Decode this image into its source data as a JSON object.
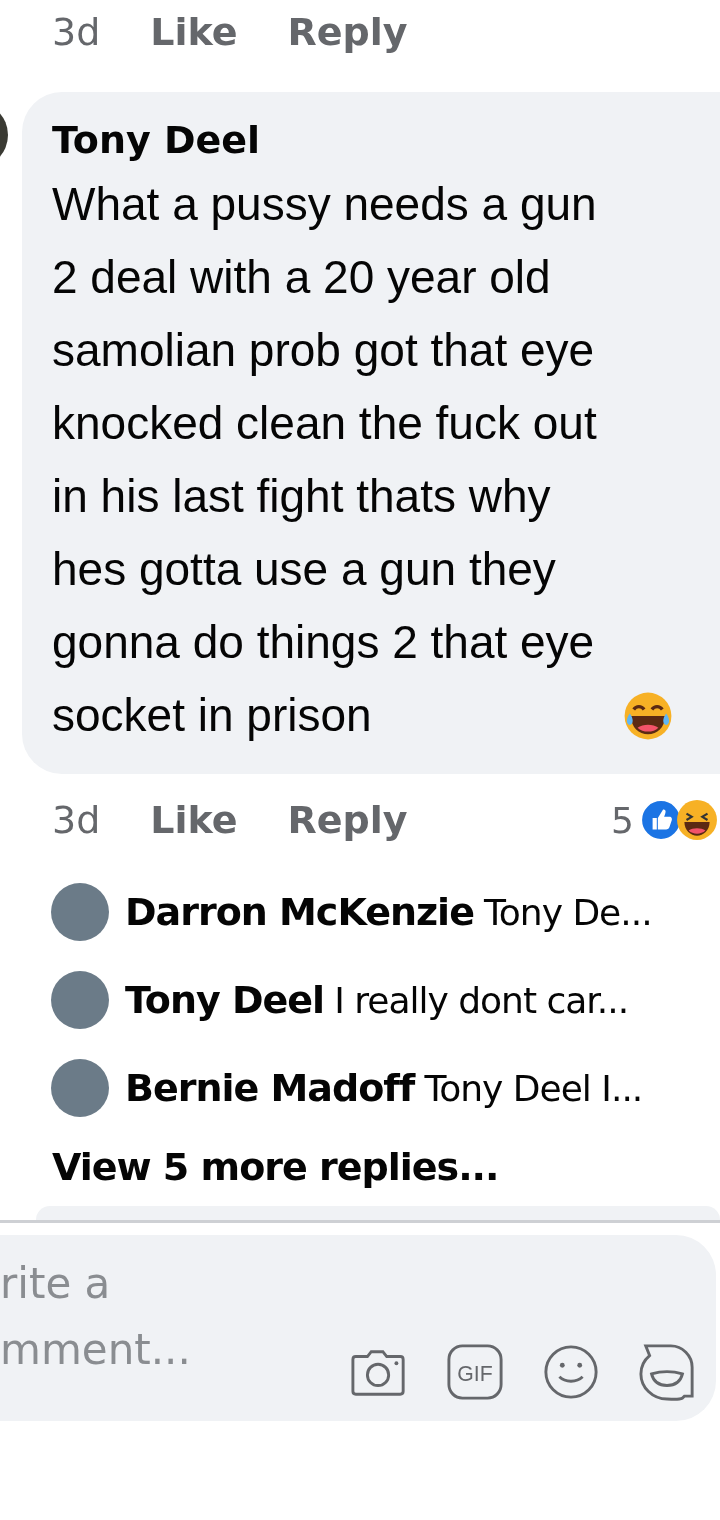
{
  "previous_comment": {
    "actions": {
      "time": "3d",
      "like": "Like",
      "reply": "Reply"
    }
  },
  "comment": {
    "author": "Tony Deel",
    "text": "What a pussy needs a gun 2 deal with a 20 year old samolian prob got that eye knocked clean the fuck out in his last fight thats why hes gotta use a gun they gonna do things 2 that eye socket in prison",
    "actions": {
      "time": "3d",
      "like": "Like",
      "reply": "Reply"
    },
    "reaction_count": "5"
  },
  "replies": [
    {
      "author": "Darron McKenzie",
      "preview": "Tony De..."
    },
    {
      "author": "Tony Deel",
      "preview": "I really dont car..."
    },
    {
      "author": "Bernie Madoff",
      "preview": "Tony Deel I..."
    }
  ],
  "view_more": "View 5 more replies...",
  "composer": {
    "placeholder": "rite a mment...",
    "gif_label": "GIF"
  }
}
